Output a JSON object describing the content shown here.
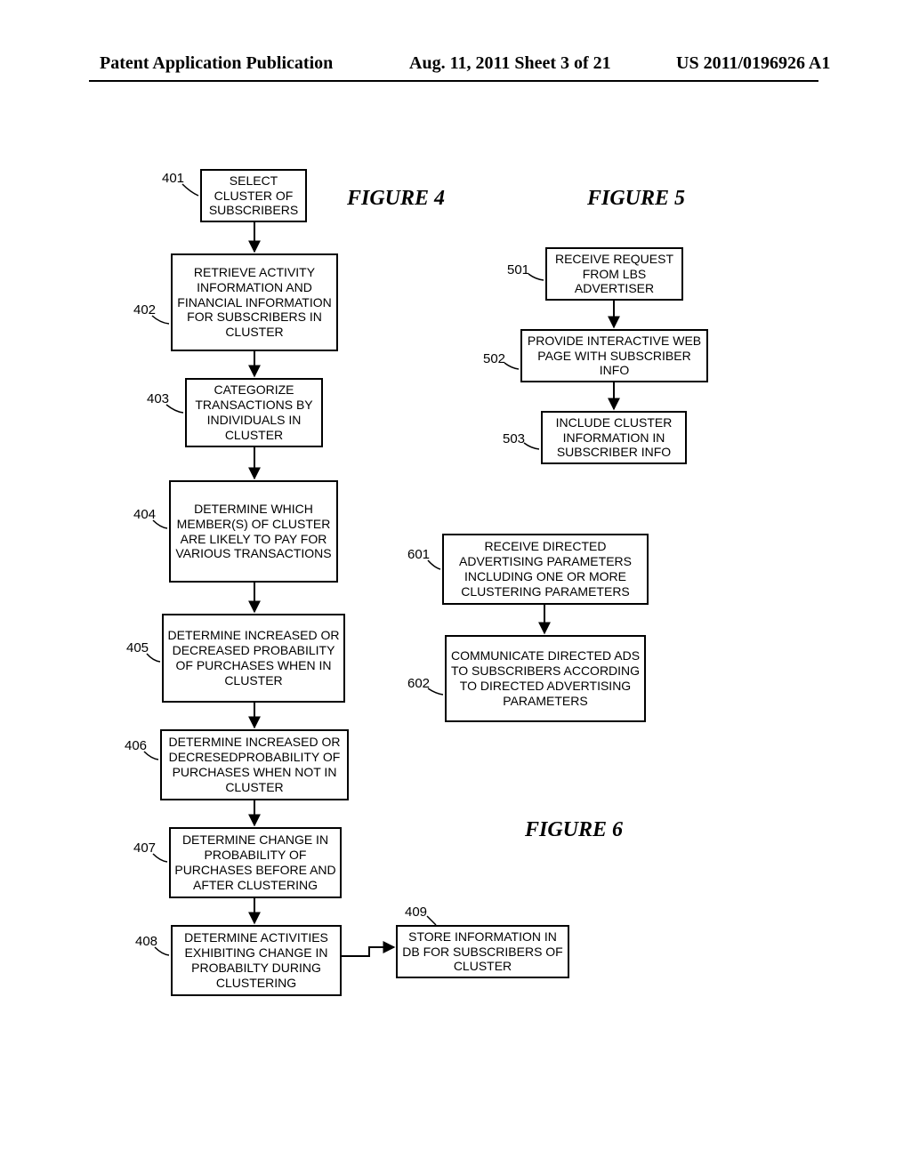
{
  "header": {
    "left": "Patent Application Publication",
    "mid": "Aug. 11, 2011  Sheet 3 of 21",
    "right": "US 2011/0196926 A1"
  },
  "figure4": {
    "label": "FIGURE 4",
    "steps": {
      "401": "SELECT CLUSTER OF SUBSCRIBERS",
      "402": "RETRIEVE ACTIVITY INFORMATION AND FINANCIAL INFORMATION FOR SUBSCRIBERS IN CLUSTER",
      "403": "CATEGORIZE TRANSACTIONS BY INDIVIDUALS IN CLUSTER",
      "404": "DETERMINE WHICH MEMBER(S) OF CLUSTER ARE LIKELY TO PAY FOR VARIOUS TRANSACTIONS",
      "405": "DETERMINE INCREASED OR DECREASED PROBABILITY OF PURCHASES WHEN IN CLUSTER",
      "406": "DETERMINE INCREASED OR DECRESEDPROBABILITY OF PURCHASES WHEN NOT IN CLUSTER",
      "407": "DETERMINE CHANGE IN PROBABILITY OF PURCHASES BEFORE AND AFTER CLUSTERING",
      "408": "DETERMINE ACTIVITIES EXHIBITING CHANGE IN PROBABILTY DURING CLUSTERING",
      "409": "STORE INFORMATION IN DB FOR SUBSCRIBERS OF CLUSTER"
    }
  },
  "figure5": {
    "label": "FIGURE 5",
    "steps": {
      "501": "RECEIVE REQUEST FROM LBS ADVERTISER",
      "502": "PROVIDE INTERACTIVE WEB PAGE WITH SUBSCRIBER INFO",
      "503": "INCLUDE CLUSTER INFORMATION IN SUBSCRIBER INFO"
    }
  },
  "figure6": {
    "label": "FIGURE 6",
    "steps": {
      "601": "RECEIVE DIRECTED ADVERTISING PARAMETERS INCLUDING ONE OR MORE CLUSTERING PARAMETERS",
      "602": "COMMUNICATE DIRECTED ADS TO SUBSCRIBERS ACCORDING TO DIRECTED ADVERTISING PARAMETERS"
    }
  },
  "nums": {
    "n401": "401",
    "n402": "402",
    "n403": "403",
    "n404": "404",
    "n405": "405",
    "n406": "406",
    "n407": "407",
    "n408": "408",
    "n409": "409",
    "n501": "501",
    "n502": "502",
    "n503": "503",
    "n601": "601",
    "n602": "602"
  }
}
